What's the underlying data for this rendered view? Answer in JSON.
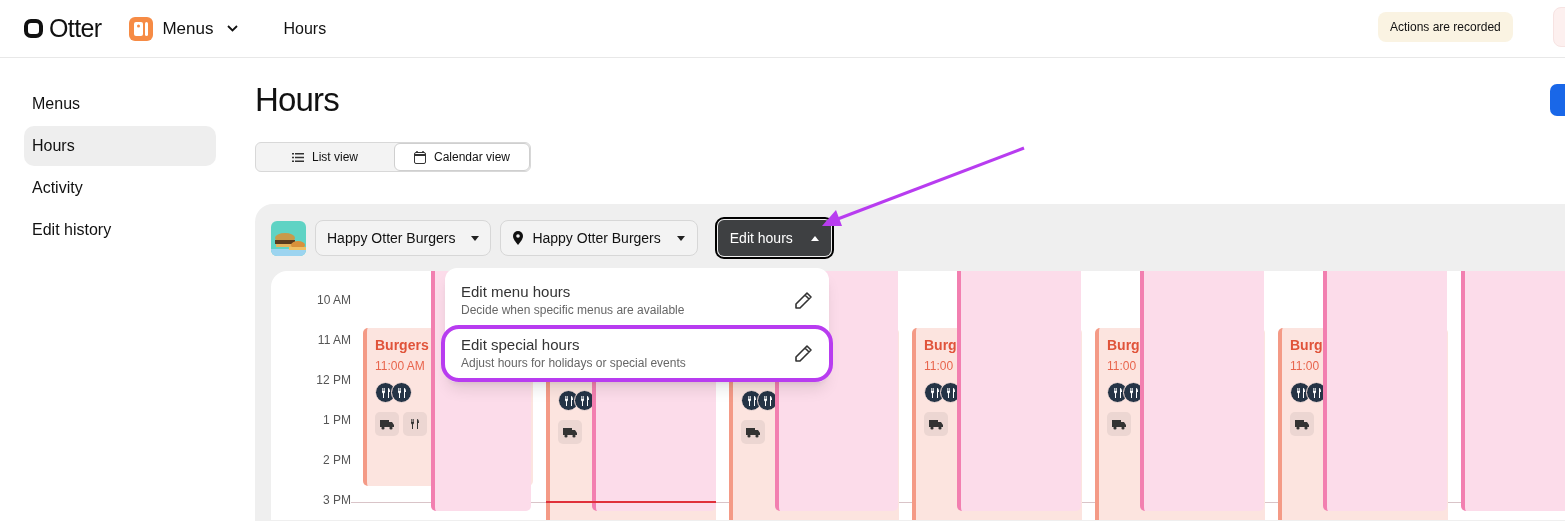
{
  "top_bar": {
    "logo": "Otter",
    "app_switcher": "Menus",
    "page": "Hours",
    "notice": "Actions are recorded"
  },
  "sidebar": {
    "items": [
      {
        "label": "Menus",
        "selected": false
      },
      {
        "label": "Hours",
        "selected": true
      },
      {
        "label": "Activity",
        "selected": false
      },
      {
        "label": "Edit history",
        "selected": false
      }
    ]
  },
  "title": "Hours",
  "view_toggle": [
    {
      "label": "List view",
      "selected": false
    },
    {
      "label": "Calendar view",
      "selected": true
    }
  ],
  "toolbar": {
    "brand_dropdown": "Happy Otter Burgers",
    "location_dropdown": "Happy Otter Burgers",
    "edit_button": "Edit hours",
    "menu_open": true
  },
  "edit_menu": [
    {
      "title": "Edit menu hours",
      "description": "Decide when specific menus are available",
      "highlighted": false
    },
    {
      "title": "Edit special hours",
      "description": "Adjust hours for holidays or special events",
      "highlighted": true
    }
  ],
  "calendar": {
    "times": [
      "10 AM",
      "11 AM",
      "12 PM",
      "1 PM",
      "2 PM",
      "3 PM"
    ],
    "days": [
      {
        "menu_block": true,
        "title": "Burgers",
        "time": "11:00 AM"
      },
      {
        "menu_block": true
      },
      {
        "menu_block": true
      },
      {
        "menu_block": true,
        "title": "Burg",
        "time": "11:00"
      },
      {
        "menu_block": true,
        "title": "Burg",
        "time": "11:00"
      },
      {
        "menu_block": true,
        "title": "Burg",
        "time": "11:00"
      },
      {
        "menu_block": false
      }
    ]
  }
}
